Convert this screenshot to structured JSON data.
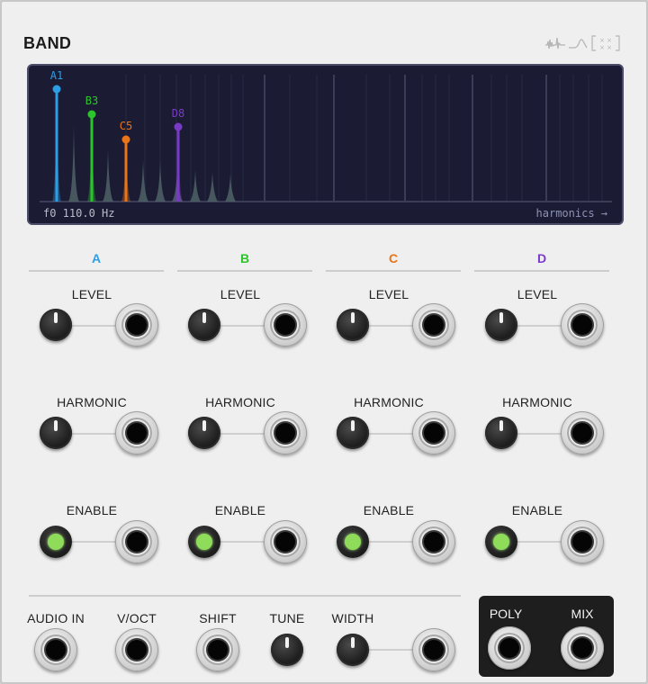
{
  "module": {
    "title": "BAND",
    "logo_icon": "waveform-filter-logo"
  },
  "display": {
    "readout": "f0 110.0 Hz",
    "harmonics_link": "harmonics →",
    "markers": [
      {
        "label": "A1",
        "color": "#2c9ee4"
      },
      {
        "label": "B3",
        "color": "#2bc52b"
      },
      {
        "label": "C5",
        "color": "#ea7418"
      },
      {
        "label": "D8",
        "color": "#7a3ac8"
      }
    ]
  },
  "columns": [
    {
      "name": "A",
      "color": "#2c9ee4"
    },
    {
      "name": "B",
      "color": "#2bc52b"
    },
    {
      "name": "C",
      "color": "#ea7418"
    },
    {
      "name": "D",
      "color": "#7a3ac8"
    }
  ],
  "rows": {
    "level": "LEVEL",
    "harmonic": "HARMONIC",
    "enable": "ENABLE"
  },
  "bottom": {
    "audio_in": "AUDIO IN",
    "voct": "V/OCT",
    "shift": "SHIFT",
    "tune": "TUNE",
    "width": "WIDTH"
  },
  "outputs": {
    "poly": "POLY",
    "mix": "MIX"
  }
}
